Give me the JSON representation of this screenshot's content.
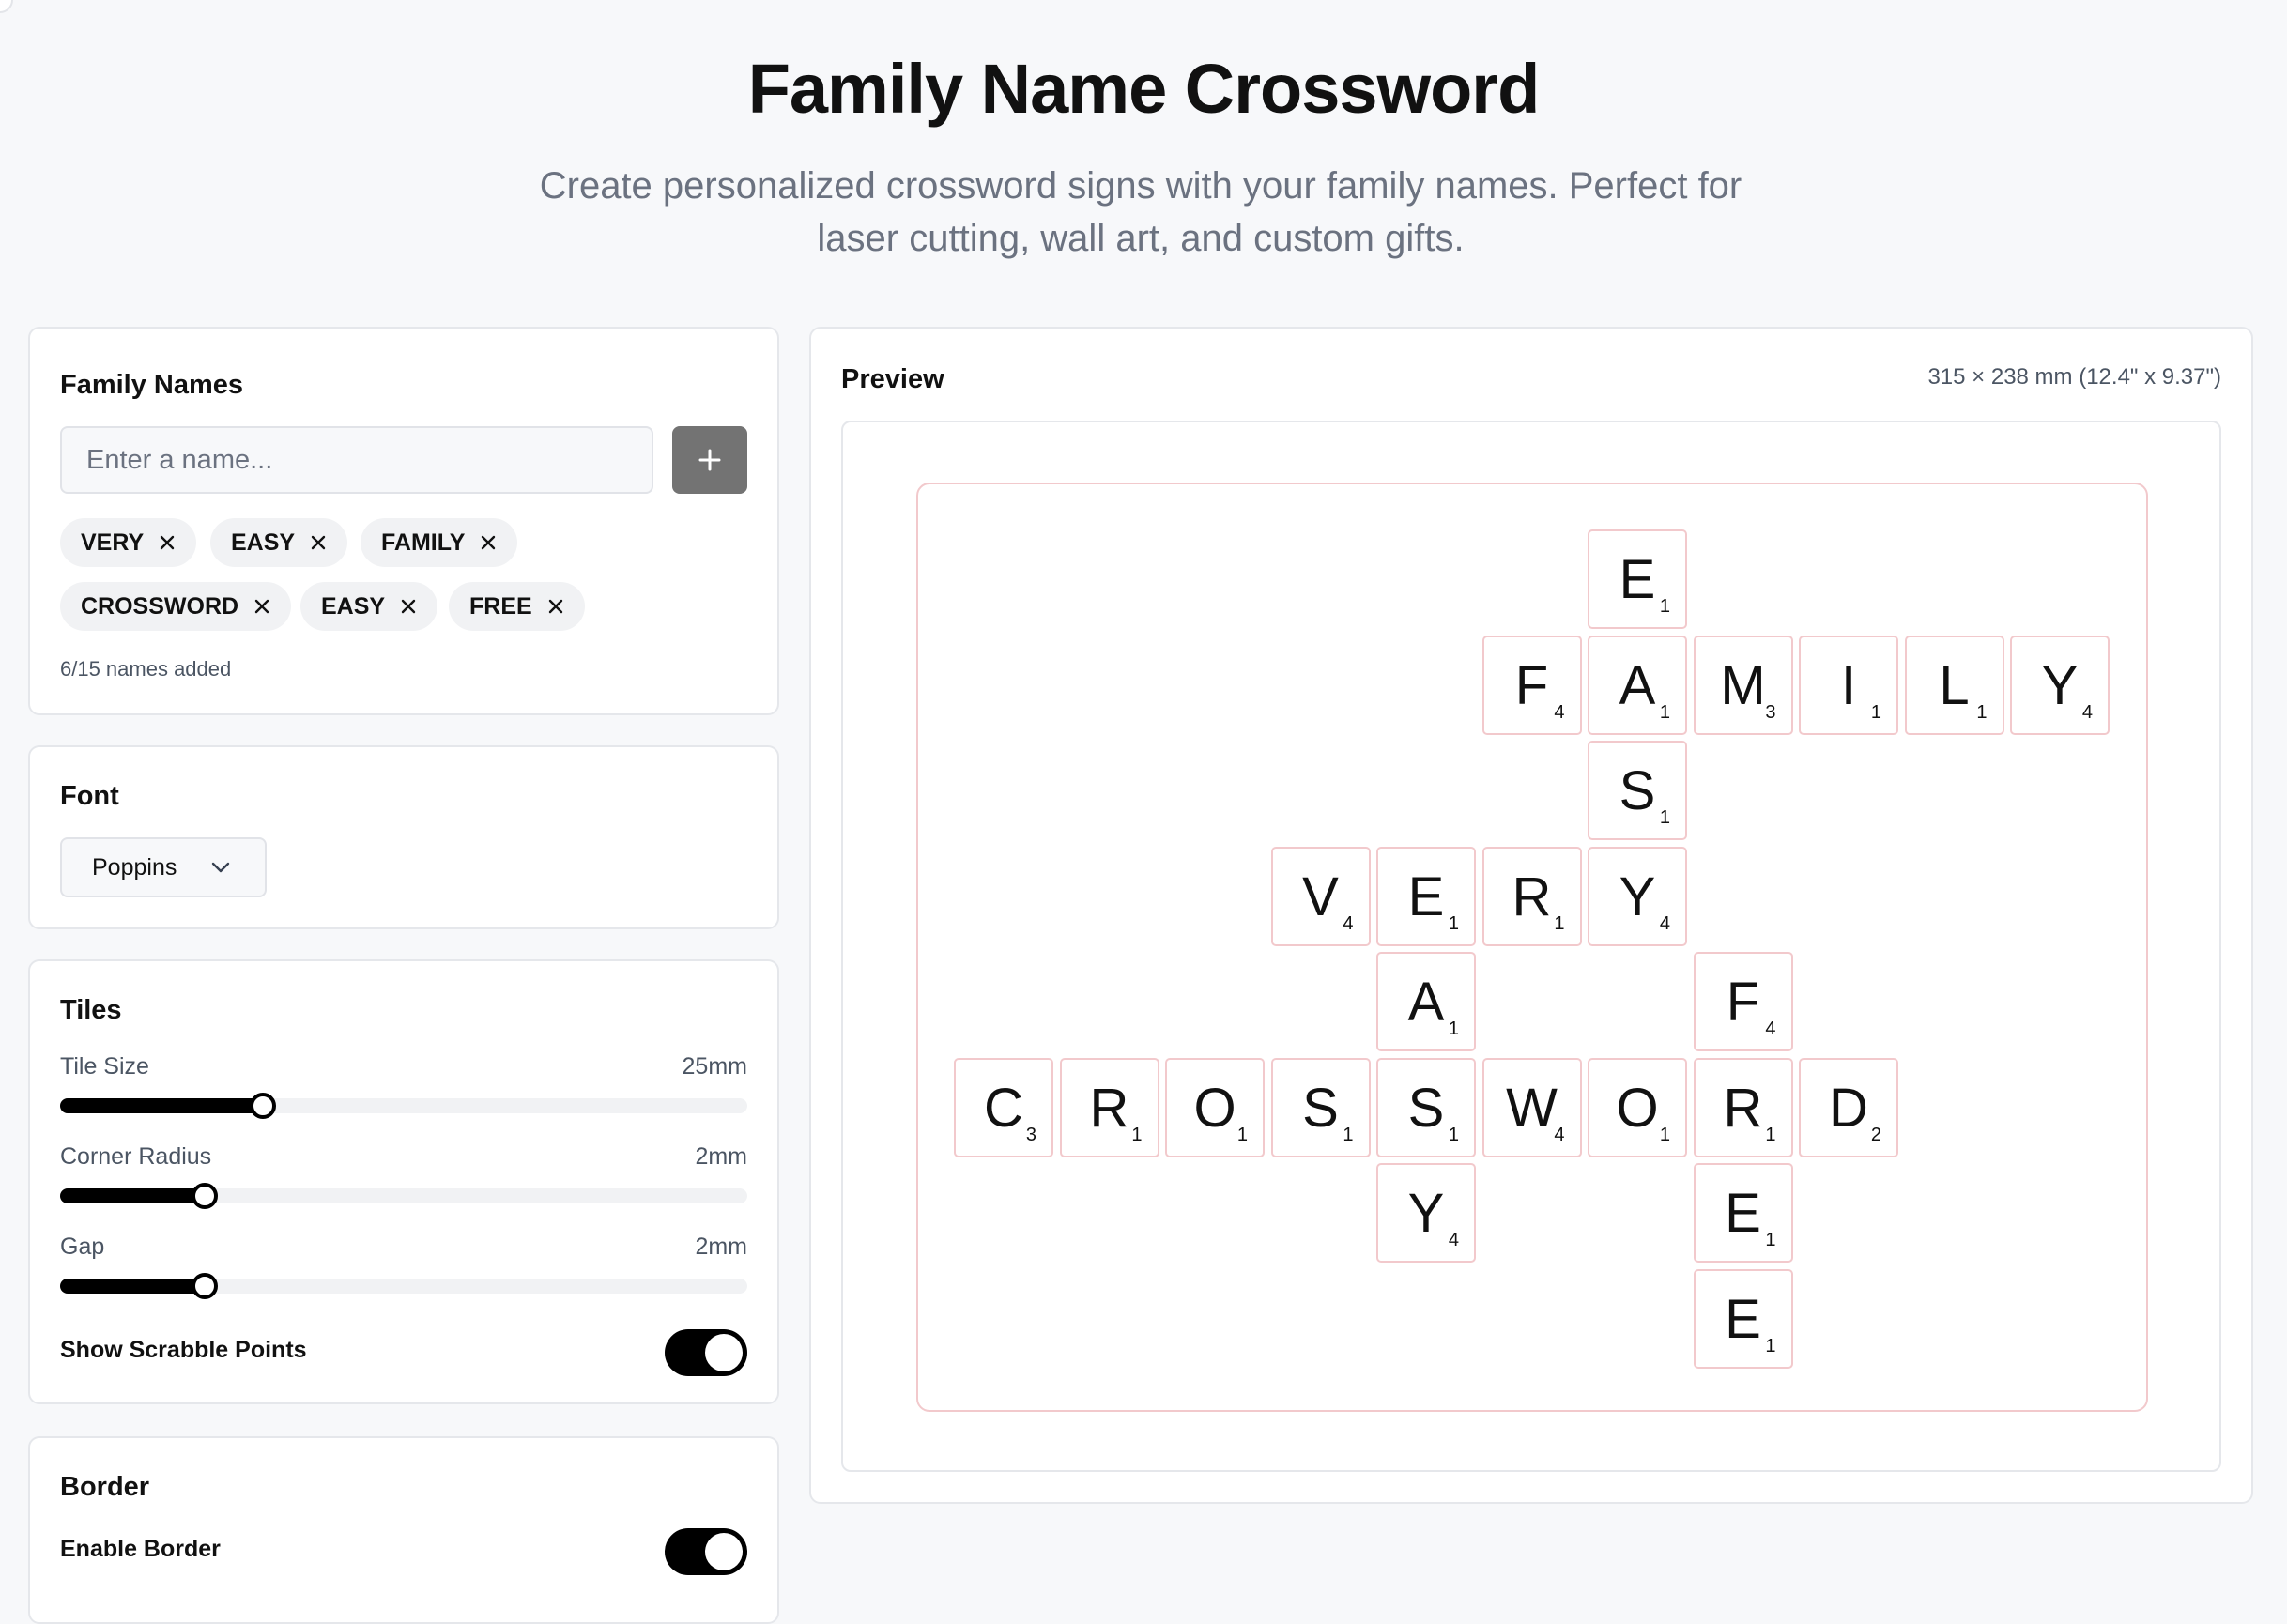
{
  "header": {
    "title": "Family Name Crossword",
    "subtitle": "Create personalized crossword signs with your family names. Perfect for laser cutting, wall art, and custom gifts."
  },
  "names_card": {
    "title": "Family Names",
    "input_placeholder": "Enter a name...",
    "add_icon": "plus-icon",
    "chips": [
      "VERY",
      "EASY",
      "FAMILY",
      "CROSSWORD",
      "EASY",
      "FREE"
    ],
    "remove_icon": "close-icon",
    "count_text": "6/15 names added"
  },
  "font_card": {
    "title": "Font",
    "selected": "Poppins",
    "chevron_icon": "chevron-down-icon"
  },
  "tiles_card": {
    "title": "Tiles",
    "sliders": [
      {
        "label": "Tile Size",
        "value": "25mm",
        "fraction": 0.295
      },
      {
        "label": "Corner Radius",
        "value": "2mm",
        "fraction": 0.21
      },
      {
        "label": "Gap",
        "value": "2mm",
        "fraction": 0.21
      }
    ],
    "toggle_label": "Show Scrabble Points",
    "toggle_on": true
  },
  "border_card": {
    "title": "Border",
    "toggle_label": "Enable Border",
    "toggle_on": true
  },
  "preview": {
    "title": "Preview",
    "dimensions": "315 × 238 mm (12.4\" x 9.37\")",
    "tiles": [
      {
        "row": 0,
        "col": 6,
        "letter": "E",
        "points": "1"
      },
      {
        "row": 1,
        "col": 5,
        "letter": "F",
        "points": "4"
      },
      {
        "row": 1,
        "col": 6,
        "letter": "A",
        "points": "1"
      },
      {
        "row": 1,
        "col": 7,
        "letter": "M",
        "points": "3"
      },
      {
        "row": 1,
        "col": 8,
        "letter": "I",
        "points": "1"
      },
      {
        "row": 1,
        "col": 9,
        "letter": "L",
        "points": "1"
      },
      {
        "row": 1,
        "col": 10,
        "letter": "Y",
        "points": "4"
      },
      {
        "row": 2,
        "col": 6,
        "letter": "S",
        "points": "1"
      },
      {
        "row": 3,
        "col": 3,
        "letter": "V",
        "points": "4"
      },
      {
        "row": 3,
        "col": 4,
        "letter": "E",
        "points": "1"
      },
      {
        "row": 3,
        "col": 5,
        "letter": "R",
        "points": "1"
      },
      {
        "row": 3,
        "col": 6,
        "letter": "Y",
        "points": "4"
      },
      {
        "row": 4,
        "col": 4,
        "letter": "A",
        "points": "1"
      },
      {
        "row": 4,
        "col": 7,
        "letter": "F",
        "points": "4"
      },
      {
        "row": 5,
        "col": 0,
        "letter": "C",
        "points": "3"
      },
      {
        "row": 5,
        "col": 1,
        "letter": "R",
        "points": "1"
      },
      {
        "row": 5,
        "col": 2,
        "letter": "O",
        "points": "1"
      },
      {
        "row": 5,
        "col": 3,
        "letter": "S",
        "points": "1"
      },
      {
        "row": 5,
        "col": 4,
        "letter": "S",
        "points": "1"
      },
      {
        "row": 5,
        "col": 5,
        "letter": "W",
        "points": "4"
      },
      {
        "row": 5,
        "col": 6,
        "letter": "O",
        "points": "1"
      },
      {
        "row": 5,
        "col": 7,
        "letter": "R",
        "points": "1"
      },
      {
        "row": 5,
        "col": 8,
        "letter": "D",
        "points": "2"
      },
      {
        "row": 6,
        "col": 4,
        "letter": "Y",
        "points": "4"
      },
      {
        "row": 6,
        "col": 7,
        "letter": "E",
        "points": "1"
      },
      {
        "row": 7,
        "col": 7,
        "letter": "E",
        "points": "1"
      }
    ]
  },
  "colors": {
    "accent": "#000000",
    "tile_border": "#f2c9cc",
    "add_button": "#737373",
    "muted_text": "#6b7280"
  }
}
